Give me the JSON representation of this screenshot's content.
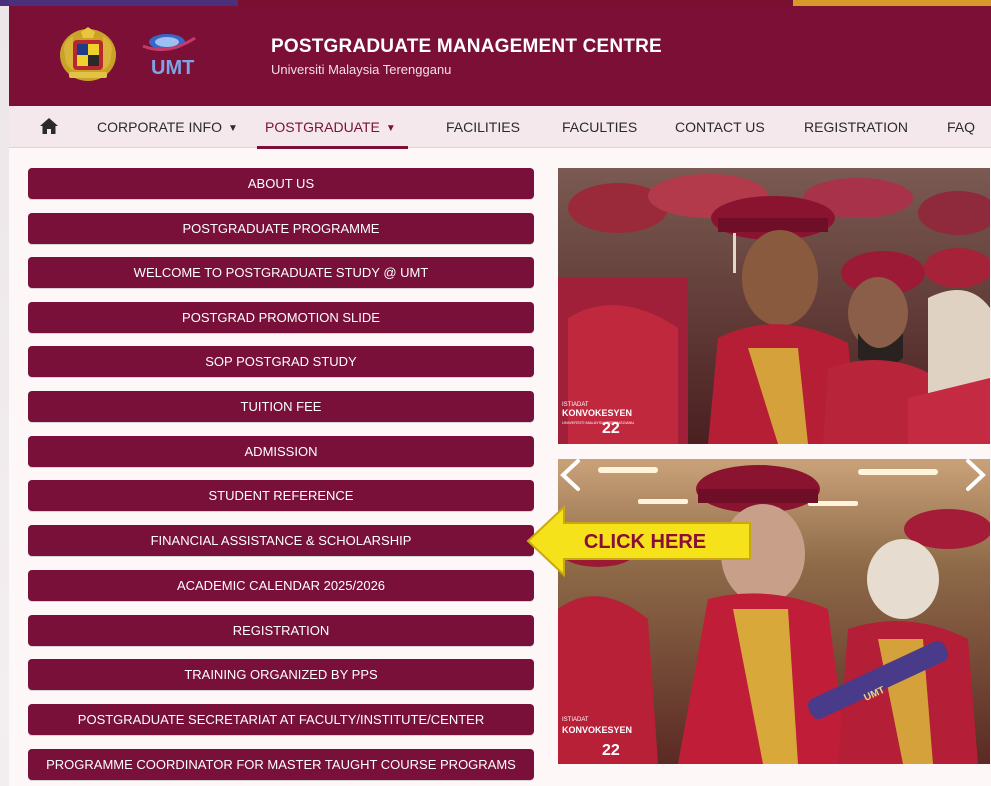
{
  "header": {
    "title": "POSTGRADUATE MANAGEMENT CENTRE",
    "subtitle": "Universiti Malaysia Terengganu",
    "logo_text": "UMT"
  },
  "nav": {
    "items": [
      {
        "label": "CORPORATE INFO",
        "has_caret": true
      },
      {
        "label": "POSTGRADUATE",
        "has_caret": true,
        "active": true
      },
      {
        "label": "FACILITIES"
      },
      {
        "label": "FACULTIES"
      },
      {
        "label": "CONTACT US"
      },
      {
        "label": "REGISTRATION"
      },
      {
        "label": "FAQ"
      }
    ]
  },
  "buttons": [
    "ABOUT US",
    "POSTGRADUATE PROGRAMME",
    "WELCOME TO POSTGRADUATE STUDY @ UMT",
    "POSTGRAD PROMOTION SLIDE",
    "SOP POSTGRAD STUDY",
    "TUITION FEE",
    "ADMISSION",
    "STUDENT REFERENCE",
    "FINANCIAL ASSISTANCE & SCHOLARSHIP",
    "ACADEMIC CALENDAR 2025/2026",
    "REGISTRATION",
    "TRAINING ORGANIZED BY PPS",
    "POSTGRADUATE SECRETARIAT AT FACULTY/INSTITUTE/CENTER",
    "PROGRAMME COORDINATOR FOR MASTER TAUGHT COURSE PROGRAMS"
  ],
  "callout": {
    "label": "CLICK HERE"
  },
  "photo_overlays": {
    "top": {
      "line1": "ISTIADAT",
      "line2": "KONVOKESYEN",
      "line3": "UNIVERSITI MALAYSIA TERENGGANU",
      "year": "22"
    },
    "bottom": {
      "line1": "ISTIADAT",
      "line2": "KONVOKESYEN",
      "year": "22"
    }
  },
  "colors": {
    "brand": "#7b0f36",
    "button": "#78103a",
    "callout": "#f5e21a"
  },
  "icons": {
    "home": "home-icon",
    "caret": "caret-down-icon",
    "prev": "chevron-left-icon",
    "next": "chevron-right-icon"
  }
}
